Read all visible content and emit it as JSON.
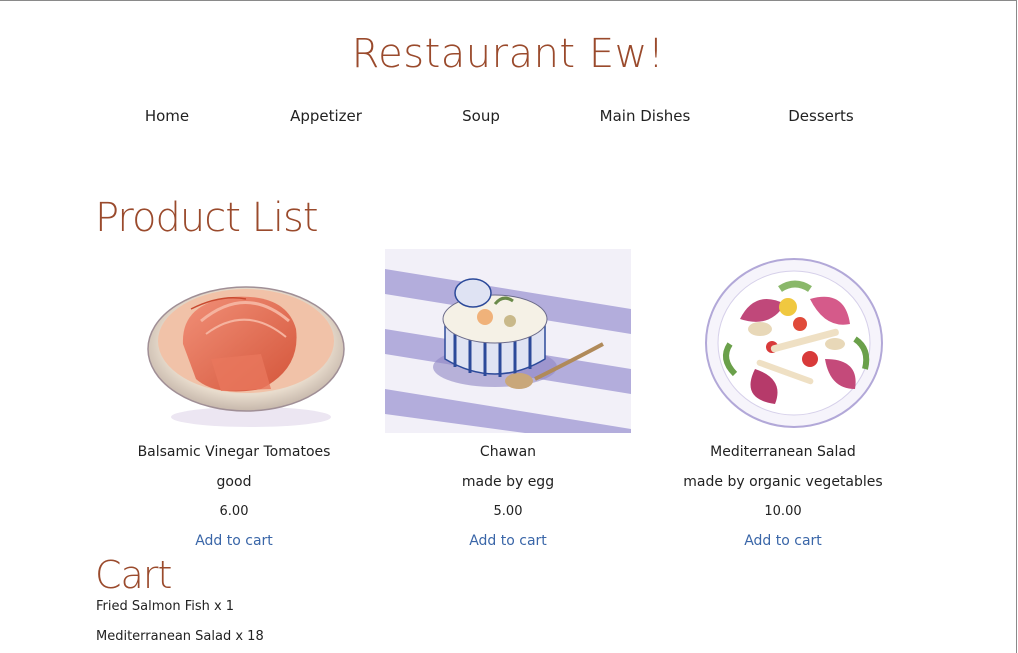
{
  "site": {
    "title": "Restaurant Ew!"
  },
  "nav": {
    "items": [
      {
        "label": "Home"
      },
      {
        "label": "Appetizer"
      },
      {
        "label": "Soup"
      },
      {
        "label": "Main Dishes"
      },
      {
        "label": "Desserts"
      }
    ]
  },
  "product_list": {
    "title": "Product List",
    "products": [
      {
        "name": "Balsamic Vinegar Tomatoes",
        "description": "good",
        "price": "6.00",
        "add_label": "Add to cart",
        "image_icon": "tomato-bowl-illustration"
      },
      {
        "name": "Chawan",
        "description": "made by egg",
        "price": "5.00",
        "add_label": "Add to cart",
        "image_icon": "chawanmushi-illustration"
      },
      {
        "name": "Mediterranean Salad",
        "description": "made by organic vegetables",
        "price": "10.00",
        "add_label": "Add to cart",
        "image_icon": "salad-plate-illustration"
      }
    ]
  },
  "cart": {
    "title": "Cart",
    "items": [
      {
        "text": "Fried Salmon Fish x 1"
      },
      {
        "text": "Mediterranean Salad x 18"
      }
    ]
  },
  "colors": {
    "accent": "#9a4a2c",
    "link": "#3a66a8",
    "text": "#222222"
  }
}
